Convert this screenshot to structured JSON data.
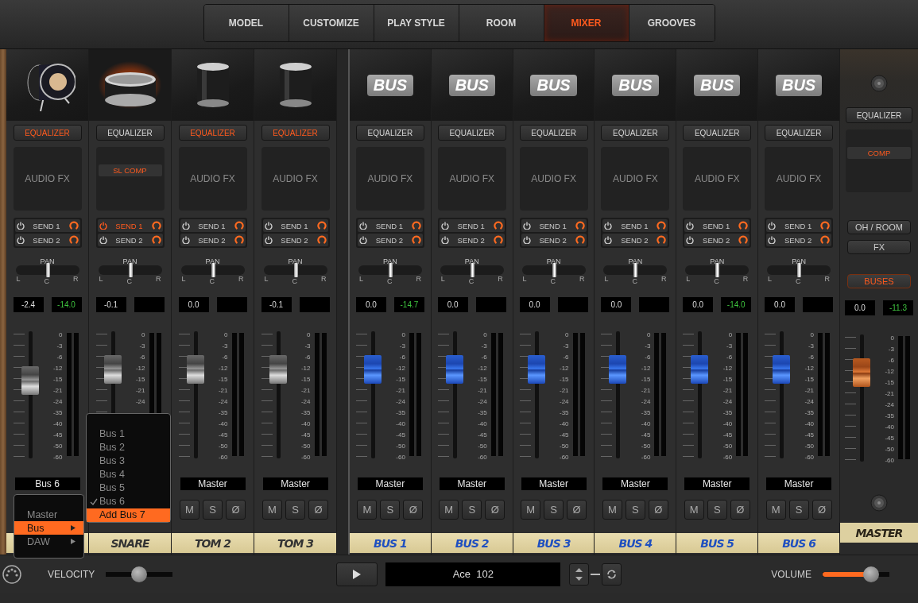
{
  "tabs": [
    {
      "label": "MODEL",
      "selected": false
    },
    {
      "label": "CUSTOMIZE",
      "selected": false
    },
    {
      "label": "PLAY STYLE",
      "selected": false
    },
    {
      "label": "ROOM",
      "selected": false
    },
    {
      "label": "MIXER",
      "selected": true
    },
    {
      "label": "GROOVES",
      "selected": false
    }
  ],
  "channels": [
    {
      "kind": "drum",
      "selected": false,
      "header": {
        "kind": "kick"
      },
      "eq": {
        "label": "EQUALIZER",
        "on": true
      },
      "fx": {
        "kind": "empty",
        "text": "AUDIO FX"
      },
      "sends": [
        {
          "label": "SEND 1",
          "on": false
        },
        {
          "label": "SEND 2",
          "on": false
        }
      ],
      "pan": {
        "label": "PAN",
        "left": "L",
        "center": "C",
        "right": "R",
        "level": 0.5
      },
      "volume": "-2.4",
      "peak": "-14.0",
      "fader": {
        "level": 0.61
      },
      "scale": [
        "0",
        "-3",
        "-6",
        "-12",
        "-15",
        "-21",
        "-24",
        "-35",
        "-40",
        "-45",
        "-50",
        "-60"
      ],
      "output": "Bus 6"
    },
    {
      "kind": "drum",
      "selected": true,
      "header": {
        "kind": "snare"
      },
      "eq": {
        "label": "EQUALIZER",
        "on": false
      },
      "fx": {
        "kind": "insert",
        "text": "SL COMP"
      },
      "sends": [
        {
          "label": "SEND 1",
          "on": true
        },
        {
          "label": "SEND 2",
          "on": false
        }
      ],
      "pan": {
        "label": "PAN",
        "left": "L",
        "center": "C",
        "right": "R",
        "level": 0.5
      },
      "volume": "-0.1",
      "fader": {
        "level": 0.7
      },
      "scale": [
        "0",
        "-3",
        "-6",
        "-12",
        "-15",
        "-21",
        "-24"
      ],
      "tape": "SNARE"
    },
    {
      "kind": "drum",
      "selected": false,
      "header": {
        "kind": "tom"
      },
      "eq": {
        "label": "EQUALIZER",
        "on": true
      },
      "fx": {
        "kind": "empty",
        "text": "AUDIO FX"
      },
      "sends": [
        {
          "label": "SEND 1",
          "on": false
        },
        {
          "label": "SEND 2",
          "on": false
        }
      ],
      "pan": {
        "label": "PAN",
        "left": "L",
        "center": "C",
        "right": "R",
        "level": 0.5
      },
      "volume": "0.0",
      "fader": {
        "level": 0.7
      },
      "scale": [
        "0",
        "-3",
        "-6",
        "-12",
        "-15",
        "-21",
        "-24",
        "-35",
        "-40",
        "-45",
        "-50",
        "-60"
      ],
      "output": "Master",
      "buttons": [
        "M",
        "S",
        "Ø"
      ],
      "tape": "TOM 2"
    },
    {
      "kind": "drum",
      "selected": false,
      "header": {
        "kind": "tom"
      },
      "eq": {
        "label": "EQUALIZER",
        "on": true
      },
      "fx": {
        "kind": "empty",
        "text": "AUDIO FX"
      },
      "sends": [
        {
          "label": "SEND 1",
          "on": false
        },
        {
          "label": "SEND 2",
          "on": false
        }
      ],
      "pan": {
        "label": "PAN",
        "left": "L",
        "center": "C",
        "right": "R",
        "level": 0.5
      },
      "volume": "-0.1",
      "fader": {
        "level": 0.7
      },
      "scale": [
        "0",
        "-3",
        "-6",
        "-12",
        "-15",
        "-21",
        "-24",
        "-35",
        "-40",
        "-45",
        "-50",
        "-60"
      ],
      "output": "Master",
      "buttons": [
        "M",
        "S",
        "Ø"
      ],
      "tape": "TOM 3"
    },
    {
      "kind": "bus",
      "selected": false,
      "header": {
        "kind": "badge",
        "text": "BUS"
      },
      "eq": {
        "label": "EQUALIZER",
        "on": false
      },
      "fx": {
        "kind": "empty",
        "text": "AUDIO FX"
      },
      "sends": [
        {
          "label": "SEND 1",
          "on": false
        },
        {
          "label": "SEND 2",
          "on": false
        }
      ],
      "pan": {
        "label": "PAN",
        "left": "L",
        "center": "C",
        "right": "R",
        "level": 0.5
      },
      "volume": "0.0",
      "peak": "-14.7",
      "fader": {
        "level": 0.7
      },
      "scale": [
        "0",
        "-3",
        "-6",
        "-12",
        "-15",
        "-21",
        "-24",
        "-35",
        "-40",
        "-45",
        "-50",
        "-60"
      ],
      "output": "Master",
      "buttons": [
        "M",
        "S",
        "Ø"
      ],
      "tape": "BUS 1"
    },
    {
      "kind": "bus",
      "selected": false,
      "header": {
        "kind": "badge",
        "text": "BUS"
      },
      "eq": {
        "label": "EQUALIZER",
        "on": false
      },
      "fx": {
        "kind": "empty",
        "text": "AUDIO FX"
      },
      "sends": [
        {
          "label": "SEND 1",
          "on": false
        },
        {
          "label": "SEND 2",
          "on": false
        }
      ],
      "pan": {
        "label": "PAN",
        "left": "L",
        "center": "C",
        "right": "R",
        "level": 0.5
      },
      "volume": "0.0",
      "fader": {
        "level": 0.7
      },
      "scale": [
        "0",
        "-3",
        "-6",
        "-12",
        "-15",
        "-21",
        "-24",
        "-35",
        "-40",
        "-45",
        "-50",
        "-60"
      ],
      "output": "Master",
      "buttons": [
        "M",
        "S",
        "Ø"
      ],
      "tape": "BUS 2"
    },
    {
      "kind": "bus",
      "selected": false,
      "header": {
        "kind": "badge",
        "text": "BUS"
      },
      "eq": {
        "label": "EQUALIZER",
        "on": false
      },
      "fx": {
        "kind": "empty",
        "text": "AUDIO FX"
      },
      "sends": [
        {
          "label": "SEND 1",
          "on": false
        },
        {
          "label": "SEND 2",
          "on": false
        }
      ],
      "pan": {
        "label": "PAN",
        "left": "L",
        "center": "C",
        "right": "R",
        "level": 0.5
      },
      "volume": "0.0",
      "fader": {
        "level": 0.7
      },
      "scale": [
        "0",
        "-3",
        "-6",
        "-12",
        "-15",
        "-21",
        "-24",
        "-35",
        "-40",
        "-45",
        "-50",
        "-60"
      ],
      "output": "Master",
      "buttons": [
        "M",
        "S",
        "Ø"
      ],
      "tape": "BUS 3"
    },
    {
      "kind": "bus",
      "selected": false,
      "header": {
        "kind": "badge",
        "text": "BUS"
      },
      "eq": {
        "label": "EQUALIZER",
        "on": false
      },
      "fx": {
        "kind": "empty",
        "text": "AUDIO FX"
      },
      "sends": [
        {
          "label": "SEND 1",
          "on": false
        },
        {
          "label": "SEND 2",
          "on": false
        }
      ],
      "pan": {
        "label": "PAN",
        "left": "L",
        "center": "C",
        "right": "R",
        "level": 0.5
      },
      "volume": "0.0",
      "fader": {
        "level": 0.7
      },
      "scale": [
        "0",
        "-3",
        "-6",
        "-12",
        "-15",
        "-21",
        "-24",
        "-35",
        "-40",
        "-45",
        "-50",
        "-60"
      ],
      "output": "Master",
      "buttons": [
        "M",
        "S",
        "Ø"
      ],
      "tape": "BUS 4"
    },
    {
      "kind": "bus",
      "selected": false,
      "header": {
        "kind": "badge",
        "text": "BUS"
      },
      "eq": {
        "label": "EQUALIZER",
        "on": false
      },
      "fx": {
        "kind": "empty",
        "text": "AUDIO FX"
      },
      "sends": [
        {
          "label": "SEND 1",
          "on": false
        },
        {
          "label": "SEND 2",
          "on": false
        }
      ],
      "pan": {
        "label": "PAN",
        "left": "L",
        "center": "C",
        "right": "R",
        "level": 0.5
      },
      "volume": "0.0",
      "peak": "-14.0",
      "fader": {
        "level": 0.7
      },
      "scale": [
        "0",
        "-3",
        "-6",
        "-12",
        "-15",
        "-21",
        "-24",
        "-35",
        "-40",
        "-45",
        "-50",
        "-60"
      ],
      "output": "Master",
      "buttons": [
        "M",
        "S",
        "Ø"
      ],
      "tape": "BUS 5"
    },
    {
      "kind": "bus",
      "selected": false,
      "header": {
        "kind": "badge",
        "text": "BUS"
      },
      "eq": {
        "label": "EQUALIZER",
        "on": false
      },
      "fx": {
        "kind": "empty",
        "text": "AUDIO FX"
      },
      "sends": [
        {
          "label": "SEND 1",
          "on": false
        },
        {
          "label": "SEND 2",
          "on": false
        }
      ],
      "pan": {
        "label": "PAN",
        "left": "L",
        "center": "C",
        "right": "R",
        "level": 0.5
      },
      "volume": "0.0",
      "fader": {
        "level": 0.7
      },
      "scale": [
        "0",
        "-3",
        "-6",
        "-12",
        "-15",
        "-21",
        "-24",
        "-35",
        "-40",
        "-45",
        "-50",
        "-60"
      ],
      "output": "Master",
      "buttons": [
        "M",
        "S",
        "Ø"
      ],
      "tape": "BUS 6"
    }
  ],
  "master": {
    "eq": {
      "label": "EQUALIZER",
      "on": false
    },
    "fx": {
      "kind": "insert",
      "text": "COMP"
    },
    "routes": [
      {
        "label": "OH / ROOM",
        "on": false
      },
      {
        "label": "FX",
        "on": false
      },
      {
        "label": "BUSES",
        "on": true
      }
    ],
    "volume": "0.0",
    "peak": "-11.3",
    "fader": {
      "level": 0.7
    },
    "scale": [
      "0",
      "-3",
      "-6",
      "-12",
      "-15",
      "-21",
      "-24",
      "-35",
      "-40",
      "-45",
      "-50",
      "-60"
    ],
    "tape": "MASTER"
  },
  "output_menu": [
    {
      "label": "Master",
      "selected": false,
      "submenu": false
    },
    {
      "label": "Bus",
      "selected": true,
      "submenu": true
    },
    {
      "label": "DAW",
      "selected": false,
      "submenu": true
    }
  ],
  "bus_menu": [
    {
      "label": "Bus 1",
      "checked": false,
      "selected": false
    },
    {
      "label": "Bus 2",
      "checked": false,
      "selected": false
    },
    {
      "label": "Bus 3",
      "checked": false,
      "selected": false
    },
    {
      "label": "Bus 4",
      "checked": false,
      "selected": false
    },
    {
      "label": "Bus 5",
      "checked": false,
      "selected": false
    },
    {
      "label": "Bus 6",
      "checked": true,
      "selected": false
    },
    {
      "label": "Add Bus 7",
      "checked": false,
      "selected": true
    }
  ],
  "bottom_bar": {
    "velocity": {
      "label": "VELOCITY",
      "level": 0.5
    },
    "groove": "Ace  102",
    "volume": {
      "label": "VOLUME",
      "level": 0.72
    }
  }
}
